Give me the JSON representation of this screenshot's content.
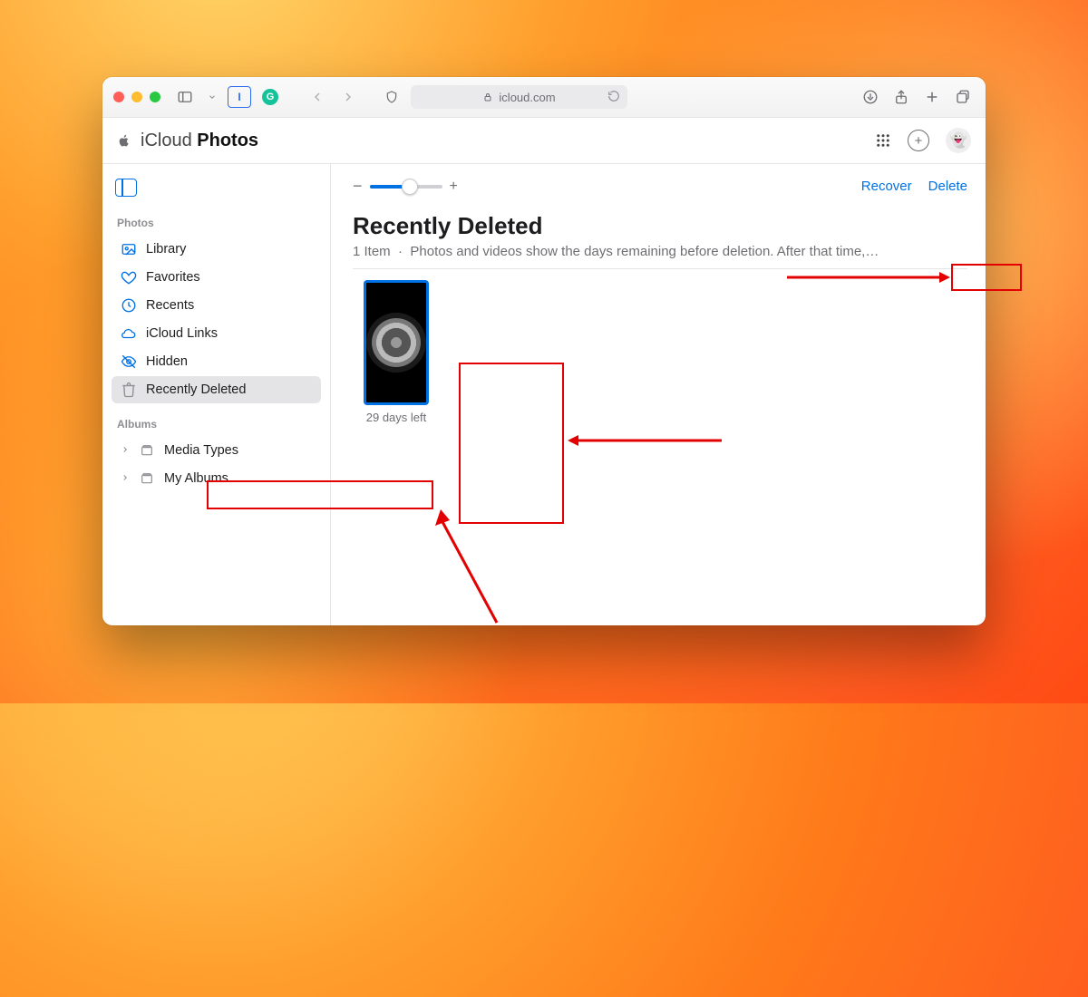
{
  "browser": {
    "url_host": "icloud.com"
  },
  "app": {
    "brand": "iCloud",
    "product": "Photos"
  },
  "sidebar": {
    "section_photos": "Photos",
    "section_albums": "Albums",
    "items": [
      {
        "label": "Library"
      },
      {
        "label": "Favorites"
      },
      {
        "label": "Recents"
      },
      {
        "label": "iCloud Links"
      },
      {
        "label": "Hidden"
      },
      {
        "label": "Recently Deleted"
      }
    ],
    "albums": [
      {
        "label": "Media Types"
      },
      {
        "label": "My Albums"
      }
    ]
  },
  "actions": {
    "recover": "Recover",
    "delete": "Delete"
  },
  "page": {
    "title": "Recently Deleted",
    "count_label": "1 Item",
    "separator": "·",
    "subtitle": "Photos and videos show the days remaining before deletion. After that time,…"
  },
  "thumb": {
    "caption": "29 days left"
  },
  "colors": {
    "accent": "#0071e3",
    "annotation": "#e30000"
  }
}
